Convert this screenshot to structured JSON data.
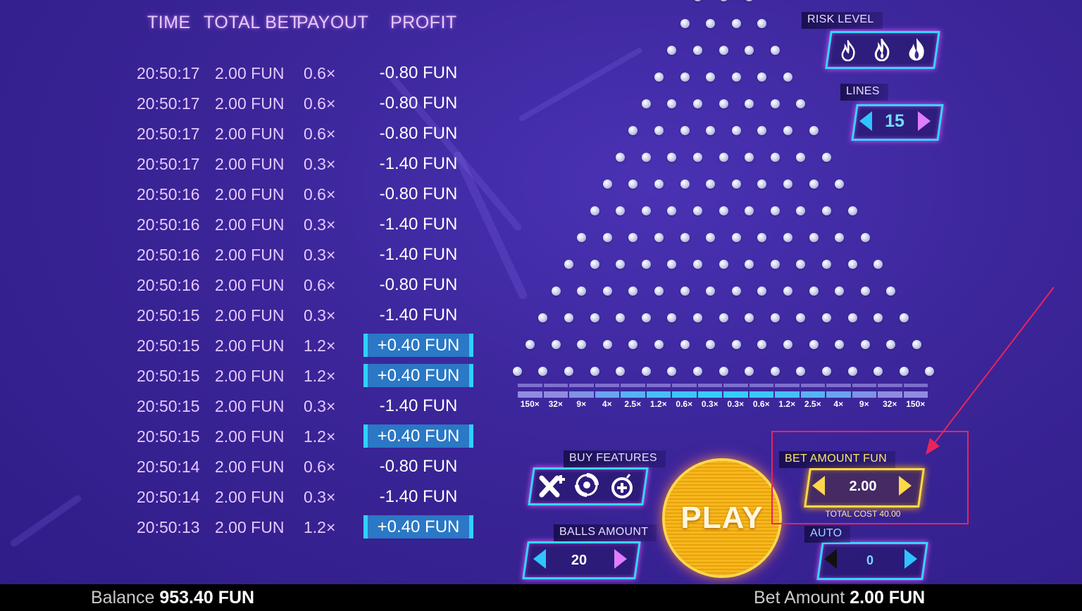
{
  "history": {
    "headers": {
      "time": "TIME",
      "total_bet": "TOTAL BET",
      "payout": "PAYOUT",
      "profit": "PROFIT"
    },
    "rows": [
      {
        "time": "20:50:17",
        "bet": "2.00 FUN",
        "payout": "0.6×",
        "profit": "-0.80 FUN",
        "win": false
      },
      {
        "time": "20:50:17",
        "bet": "2.00 FUN",
        "payout": "0.6×",
        "profit": "-0.80 FUN",
        "win": false
      },
      {
        "time": "20:50:17",
        "bet": "2.00 FUN",
        "payout": "0.6×",
        "profit": "-0.80 FUN",
        "win": false
      },
      {
        "time": "20:50:17",
        "bet": "2.00 FUN",
        "payout": "0.3×",
        "profit": "-1.40 FUN",
        "win": false
      },
      {
        "time": "20:50:16",
        "bet": "2.00 FUN",
        "payout": "0.6×",
        "profit": "-0.80 FUN",
        "win": false
      },
      {
        "time": "20:50:16",
        "bet": "2.00 FUN",
        "payout": "0.3×",
        "profit": "-1.40 FUN",
        "win": false
      },
      {
        "time": "20:50:16",
        "bet": "2.00 FUN",
        "payout": "0.3×",
        "profit": "-1.40 FUN",
        "win": false
      },
      {
        "time": "20:50:16",
        "bet": "2.00 FUN",
        "payout": "0.6×",
        "profit": "-0.80 FUN",
        "win": false
      },
      {
        "time": "20:50:15",
        "bet": "2.00 FUN",
        "payout": "0.3×",
        "profit": "-1.40 FUN",
        "win": false
      },
      {
        "time": "20:50:15",
        "bet": "2.00 FUN",
        "payout": "1.2×",
        "profit": "+0.40 FUN",
        "win": true
      },
      {
        "time": "20:50:15",
        "bet": "2.00 FUN",
        "payout": "1.2×",
        "profit": "+0.40 FUN",
        "win": true
      },
      {
        "time": "20:50:15",
        "bet": "2.00 FUN",
        "payout": "0.3×",
        "profit": "-1.40 FUN",
        "win": false
      },
      {
        "time": "20:50:15",
        "bet": "2.00 FUN",
        "payout": "1.2×",
        "profit": "+0.40 FUN",
        "win": true
      },
      {
        "time": "20:50:14",
        "bet": "2.00 FUN",
        "payout": "0.6×",
        "profit": "-0.80 FUN",
        "win": false
      },
      {
        "time": "20:50:14",
        "bet": "2.00 FUN",
        "payout": "0.3×",
        "profit": "-1.40 FUN",
        "win": false
      },
      {
        "time": "20:50:13",
        "bet": "2.00 FUN",
        "payout": "1.2×",
        "profit": "+0.40 FUN",
        "win": true
      }
    ]
  },
  "board": {
    "multipliers": [
      "150×",
      "32×",
      "9×",
      "4×",
      "2.5×",
      "1.2×",
      "0.6×",
      "0.3×",
      "0.3×",
      "0.6×",
      "1.2×",
      "2.5×",
      "4×",
      "9×",
      "32×",
      "150×"
    ]
  },
  "controls": {
    "risk_level": {
      "label": "RISK LEVEL",
      "icons": [
        "flame-low-icon",
        "flame-medium-icon",
        "flame-high-icon"
      ]
    },
    "lines": {
      "label": "LINES",
      "value": "15"
    },
    "buy_features": {
      "label": "BUY FEATURES",
      "icons": [
        "multiplier-feature-icon",
        "spin-feature-icon",
        "bomb-feature-icon"
      ]
    },
    "balls_amount": {
      "label": "BALLS AMOUNT",
      "value": "20"
    },
    "play": {
      "label": "PLAY"
    },
    "bet_amount": {
      "label": "BET AMOUNT FUN",
      "value": "2.00",
      "total_cost": "TOTAL COST 40.00"
    },
    "auto": {
      "label": "AUTO",
      "value": "0"
    }
  },
  "footer": {
    "balance_label": "Balance",
    "balance_value": "953.40 FUN",
    "bet_label": "Bet Amount",
    "bet_value": "2.00 FUN"
  },
  "colors": {
    "background": "#3b2598",
    "neon_blue": "#34d7ff",
    "neon_pink": "#e657ff",
    "gold": "#ffd84a",
    "win_row": "#2a78c6",
    "annotation_red": "#e8245c"
  }
}
